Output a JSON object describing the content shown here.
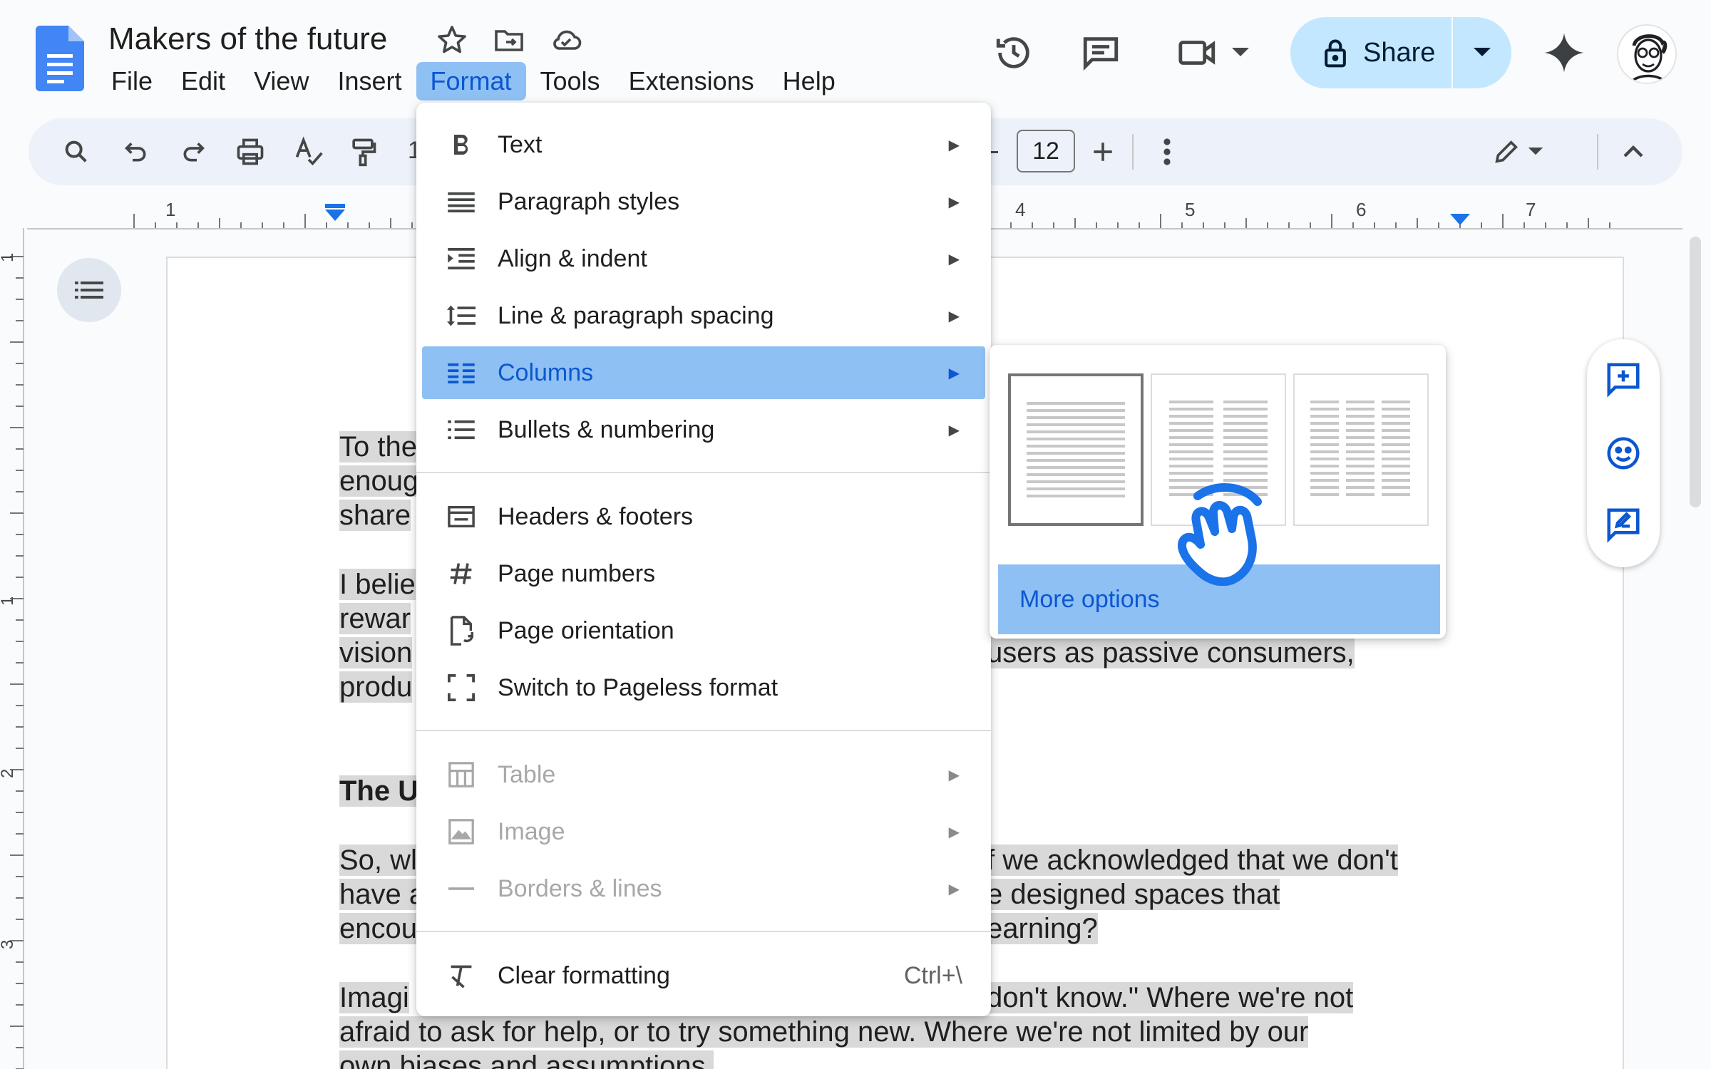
{
  "document": {
    "title": "Makers of the future",
    "lines": [
      {
        "text": "To the",
        "bold": false
      },
      {
        "text": "enoug",
        "bold": false
      },
      {
        "text": "share",
        "bold": false
      },
      {
        "text": "I belie",
        "bold": false
      },
      {
        "text": "rewar",
        "bold": false
      },
      {
        "text": "vision",
        "bold": false
      },
      {
        "text": "produ",
        "bold": false
      },
      {
        "text": "The U",
        "bold": true
      },
      {
        "text": "So, wl",
        "bold": false
      },
      {
        "text": "have a",
        "bold": false
      },
      {
        "text": "encou",
        "bold": false
      },
      {
        "text": "Imagi",
        "bold": false
      },
      {
        "text": "afraid to ask for help, or to try something new. Where we're not limited by our",
        "bold": false
      },
      {
        "text": "own biases and assumptions.",
        "bold": false
      }
    ],
    "right_fragments": [
      "users as passive consumers,",
      "f we acknowledged that we don't",
      "e designed spaces that",
      "earning?",
      "don't know.\" Where we're not"
    ]
  },
  "menubar": {
    "items": [
      "File",
      "Edit",
      "View",
      "Insert",
      "Format",
      "Tools",
      "Extensions",
      "Help"
    ],
    "active": "Format"
  },
  "header": {
    "share_label": "Share"
  },
  "toolbar": {
    "font_size": "12"
  },
  "ruler": {
    "labels": [
      "1",
      "4",
      "5",
      "6",
      "7"
    ],
    "vertical_labels": [
      "1",
      "1",
      "2",
      "3"
    ]
  },
  "format_menu": {
    "items": [
      {
        "label": "Text",
        "icon": "bold-icon",
        "submenu": true
      },
      {
        "label": "Paragraph styles",
        "icon": "paragraph-styles-icon",
        "submenu": true
      },
      {
        "label": "Align & indent",
        "icon": "indent-icon",
        "submenu": true
      },
      {
        "label": "Line & paragraph spacing",
        "icon": "line-spacing-icon",
        "submenu": true
      },
      {
        "label": "Columns",
        "icon": "columns-icon",
        "submenu": true,
        "highlighted": true
      },
      {
        "label": "Bullets & numbering",
        "icon": "bullets-icon",
        "submenu": true
      },
      {
        "label": "Headers & footers",
        "icon": "headers-footers-icon",
        "submenu": false
      },
      {
        "label": "Page numbers",
        "icon": "hash-icon",
        "submenu": false
      },
      {
        "label": "Page orientation",
        "icon": "page-orientation-icon",
        "submenu": false
      },
      {
        "label": "Switch to Pageless format",
        "icon": "pageless-icon",
        "submenu": false
      },
      {
        "label": "Table",
        "icon": "table-icon",
        "submenu": true,
        "disabled": true
      },
      {
        "label": "Image",
        "icon": "image-icon",
        "submenu": true,
        "disabled": true
      },
      {
        "label": "Borders & lines",
        "icon": "borders-icon",
        "submenu": true,
        "disabled": true
      },
      {
        "label": "Clear formatting",
        "icon": "clear-formatting-icon",
        "submenu": false,
        "shortcut": "Ctrl+\\"
      }
    ]
  },
  "columns_menu": {
    "options": [
      "one-column",
      "two-columns",
      "three-columns"
    ],
    "selected": "one-column",
    "more_options_label": "More options"
  },
  "colors": {
    "accent": "#0b57d0",
    "menu_highlight": "#8fc0f4",
    "share_bg": "#c2e7ff",
    "text_highlight": "#d9d9d9"
  }
}
